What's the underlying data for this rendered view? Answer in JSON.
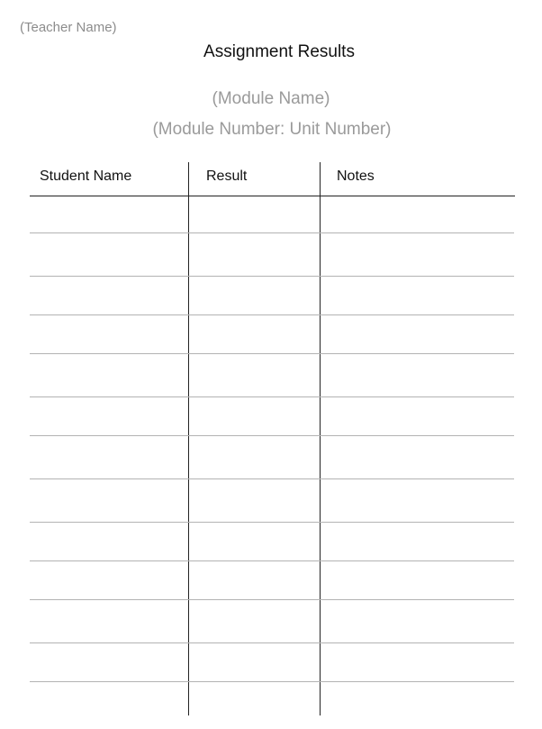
{
  "header": {
    "teacher_name": "(Teacher Name)",
    "title": "Assignment Results",
    "module_name": "(Module Name)",
    "module_number": "(Module Number: Unit Number)"
  },
  "table": {
    "columns": [
      "Student Name",
      "Result",
      "Notes"
    ],
    "row_count": 13
  }
}
